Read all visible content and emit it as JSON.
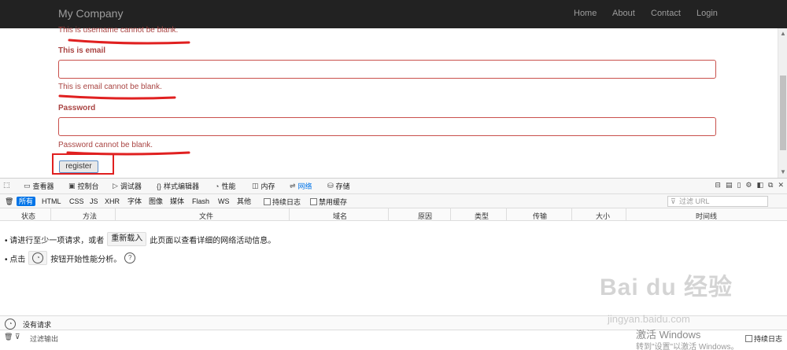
{
  "navbar": {
    "brand": "My Company",
    "links": [
      "Home",
      "About",
      "Contact",
      "Login"
    ]
  },
  "form": {
    "username_error": "This is username cannot be blank.",
    "email_label": "This is email",
    "email_value": "",
    "email_error": "This is email cannot be blank.",
    "password_label": "Password",
    "password_value": "",
    "password_error": "Password cannot be blank.",
    "register_label": "register"
  },
  "devtools": {
    "tabs": [
      "查看器",
      "控制台",
      "调试器",
      "样式编辑器",
      "性能",
      "内存",
      "网络",
      "存储"
    ],
    "active_tab": "网络",
    "filter_types": [
      "所有",
      "HTML",
      "CSS",
      "JS",
      "XHR",
      "字体",
      "图像",
      "媒体",
      "Flash",
      "WS",
      "其他"
    ],
    "persist_logs": "持续日志",
    "disable_cache": "禁用缓存",
    "url_filter_placeholder": "过滤 URL",
    "columns": [
      "状态",
      "方法",
      "文件",
      "域名",
      "原因",
      "类型",
      "传输",
      "大小",
      "时间线"
    ],
    "hint1_before": "• 请进行至少一项请求，或者",
    "hint1_button": "重新载入",
    "hint1_after": "此页面以查看详细的网络活动信息。",
    "hint2_before": "• 点击",
    "hint2_after": "按钮开始性能分析。",
    "status_text": "没有请求",
    "console_filter": "过滤输出",
    "console_persist": "持续日志"
  },
  "watermark": {
    "windows_title": "激活 Windows",
    "windows_sub": "转到\"设置\"以激活 Windows。",
    "baidu_logo": "Bai du 经验",
    "baidu_url": "jingyan.baidu.com"
  },
  "colors": {
    "error": "#a94442",
    "navbar_bg": "#222222",
    "active_blue": "#0074e8",
    "annotation_red": "#e02020"
  }
}
